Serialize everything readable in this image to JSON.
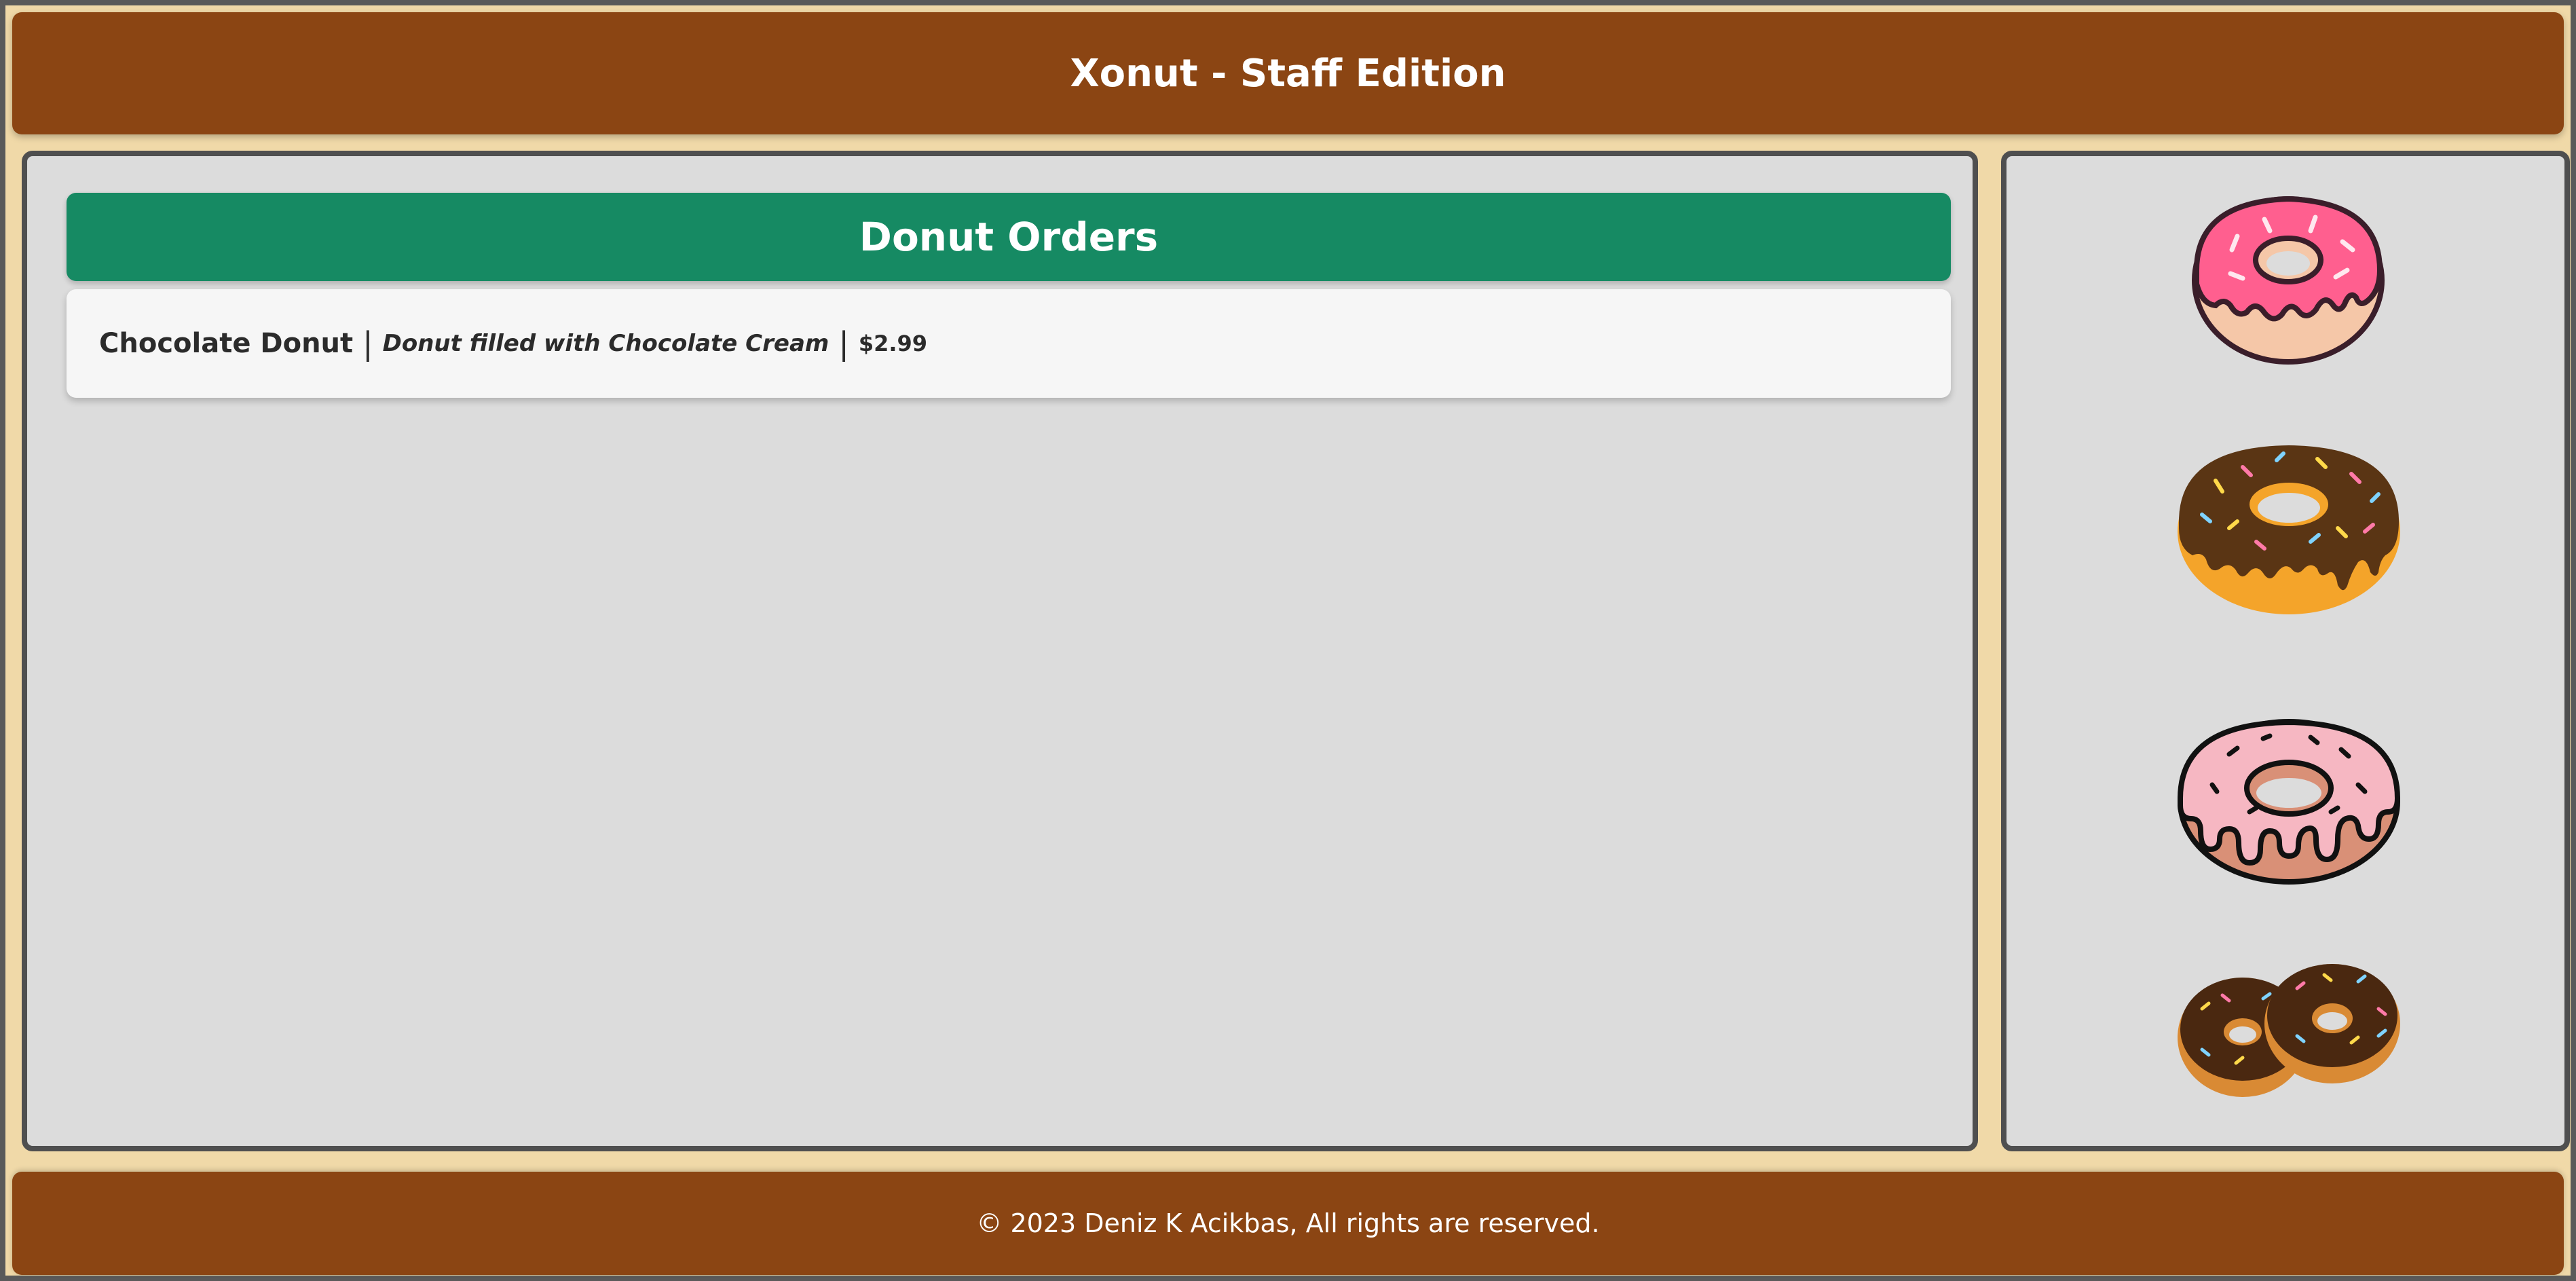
{
  "header": {
    "title": "Xonut - Staff Edition"
  },
  "orders": {
    "title": "Donut Orders",
    "items": [
      {
        "name": "Chocolate Donut",
        "description": "Donut filled with Chocolate Cream",
        "price": "$2.99"
      }
    ]
  },
  "sidebar": {
    "images": [
      "pink-glazed-donut-icon",
      "chocolate-sprinkle-donut-icon",
      "pink-outline-donut-icon",
      "two-chocolate-donuts-icon"
    ]
  },
  "footer": {
    "copyright": "© 2023 Deniz K Acikbas, All rights are reserved."
  },
  "colors": {
    "header_bg": "#8b4513",
    "page_bg": "#f0d9a8",
    "title_bar": "#168a63",
    "panel_bg": "#dcdcdc"
  }
}
